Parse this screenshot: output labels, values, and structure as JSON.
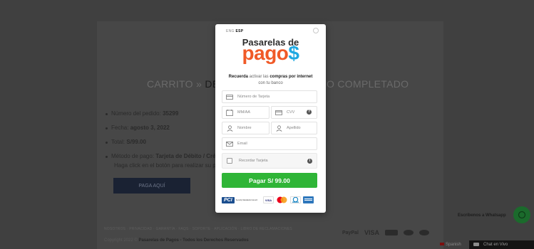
{
  "background": {
    "steps": {
      "cart": "CARRITO",
      "sep": "»",
      "detail": "DET",
      "completed": "O COMPLETADO"
    },
    "details": [
      {
        "label": "Número del pedido:",
        "value": "35299"
      },
      {
        "label": "Fecha:",
        "value": "agosto 3, 2022"
      },
      {
        "label": "Total:",
        "value": "S/99.00"
      },
      {
        "label": "Método de pago:",
        "value": "Tarjeta de Débito / Cré"
      }
    ],
    "click_hint": "Haga click en el botón para realizar su pa",
    "pay_here_button": "PAGA AQUÍ",
    "footer_links": "NOSOTROS · PRIVACIDAD · GARANTÍA · FAQS · SOPORTE · APLICACIÓN · LIBRO DE RECLAMACIONES",
    "copyright_prefix": "Copyright 2022 ©",
    "copyright_bold": "Pasarelas de Pagos - Todos los Derechos Reservados",
    "footer_payments": [
      "PayPal",
      "VISA"
    ],
    "whatsapp_text": "Escríbenos a Whatsapp",
    "language": "Spanish",
    "chat": "Chat en Vivo"
  },
  "modal": {
    "lang": {
      "eng": "ENG",
      "esp": "ESP"
    },
    "logo_top": "Pasarelas de",
    "logo_main": "pago",
    "logo_dollar": "$",
    "tagline": {
      "w1": "Recuerda",
      "w2": "activar las",
      "w3": "compras por internet",
      "w4": "con tu banco"
    },
    "card_number_placeholder": "Número de Tarjeta",
    "expiry_placeholder": "MM/AA",
    "cvv_placeholder": "CVV",
    "first_name_placeholder": "Nombre",
    "last_name_placeholder": "Apellido",
    "email_placeholder": "Email",
    "remember_label": "Recordar Tarjeta",
    "pay_button": "Pagar S/ 99.00",
    "pci_logo": "PCI",
    "pci_text": "Security Standards Council",
    "card_brands": [
      "VISA",
      "Mastercard",
      "Diners Club",
      "American Express"
    ],
    "colors": {
      "accent": "#2fb537",
      "logo_orange": "#f05a28",
      "logo_blue": "#1fa8e1"
    }
  }
}
